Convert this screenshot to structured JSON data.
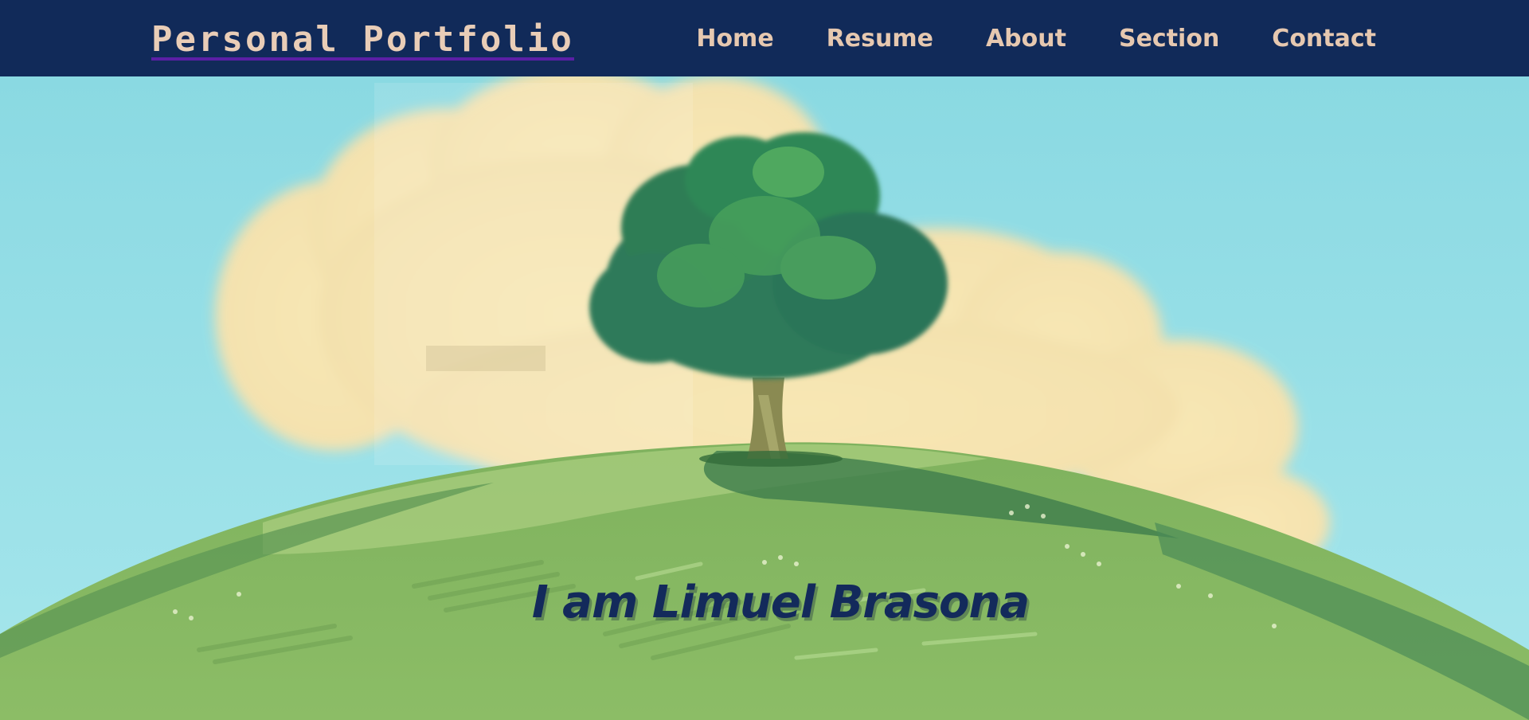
{
  "header": {
    "brand": "Personal Portfolio",
    "nav": [
      {
        "label": "Home"
      },
      {
        "label": "Resume"
      },
      {
        "label": "About"
      },
      {
        "label": "Section"
      },
      {
        "label": "Contact"
      }
    ]
  },
  "hero": {
    "heading": "I am Limuel Brasona"
  },
  "colors": {
    "navbar_bg": "#112a59",
    "nav_text": "#e6c8b0",
    "brand_underline": "#5b1fa6",
    "heading_text": "#132a5b",
    "sky": "#8fdbe3",
    "hill": "#86b863"
  }
}
